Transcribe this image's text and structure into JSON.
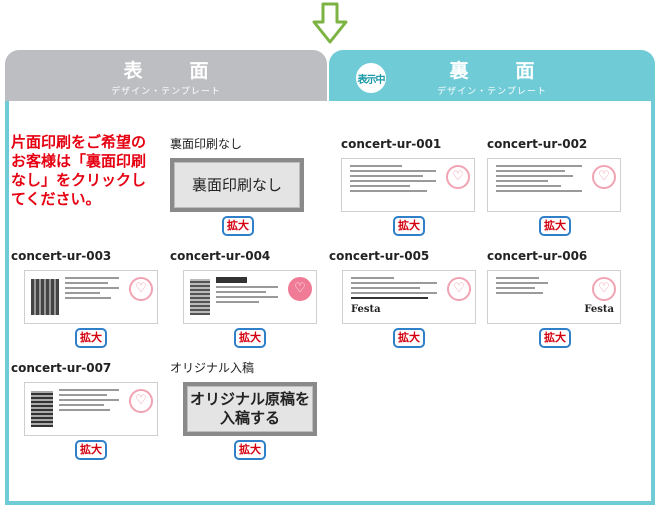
{
  "tabs": {
    "front": {
      "title": "表　面",
      "subtitle": "デザイン・テンプレート"
    },
    "back": {
      "title": "裏　面",
      "subtitle": "デザイン・テンプレート",
      "badge": "表示中"
    }
  },
  "note": "片面印刷をご希望のお客様は「裏面印刷なし」をクリックしてください。",
  "zoom_label": "拡大",
  "items": [
    {
      "label": "裏面印刷なし",
      "button_text": "裏面印刷なし"
    },
    {
      "label": "concert-ur-001"
    },
    {
      "label": "concert-ur-002"
    },
    {
      "label": "concert-ur-003"
    },
    {
      "label": "concert-ur-004"
    },
    {
      "label": "concert-ur-005",
      "logo": "Festa"
    },
    {
      "label": "concert-ur-006",
      "logo": "Festa"
    },
    {
      "label": "concert-ur-007"
    },
    {
      "label": "オリジナル入稿",
      "button_line1": "オリジナル原稿を",
      "button_line2": "入稿する"
    }
  ]
}
